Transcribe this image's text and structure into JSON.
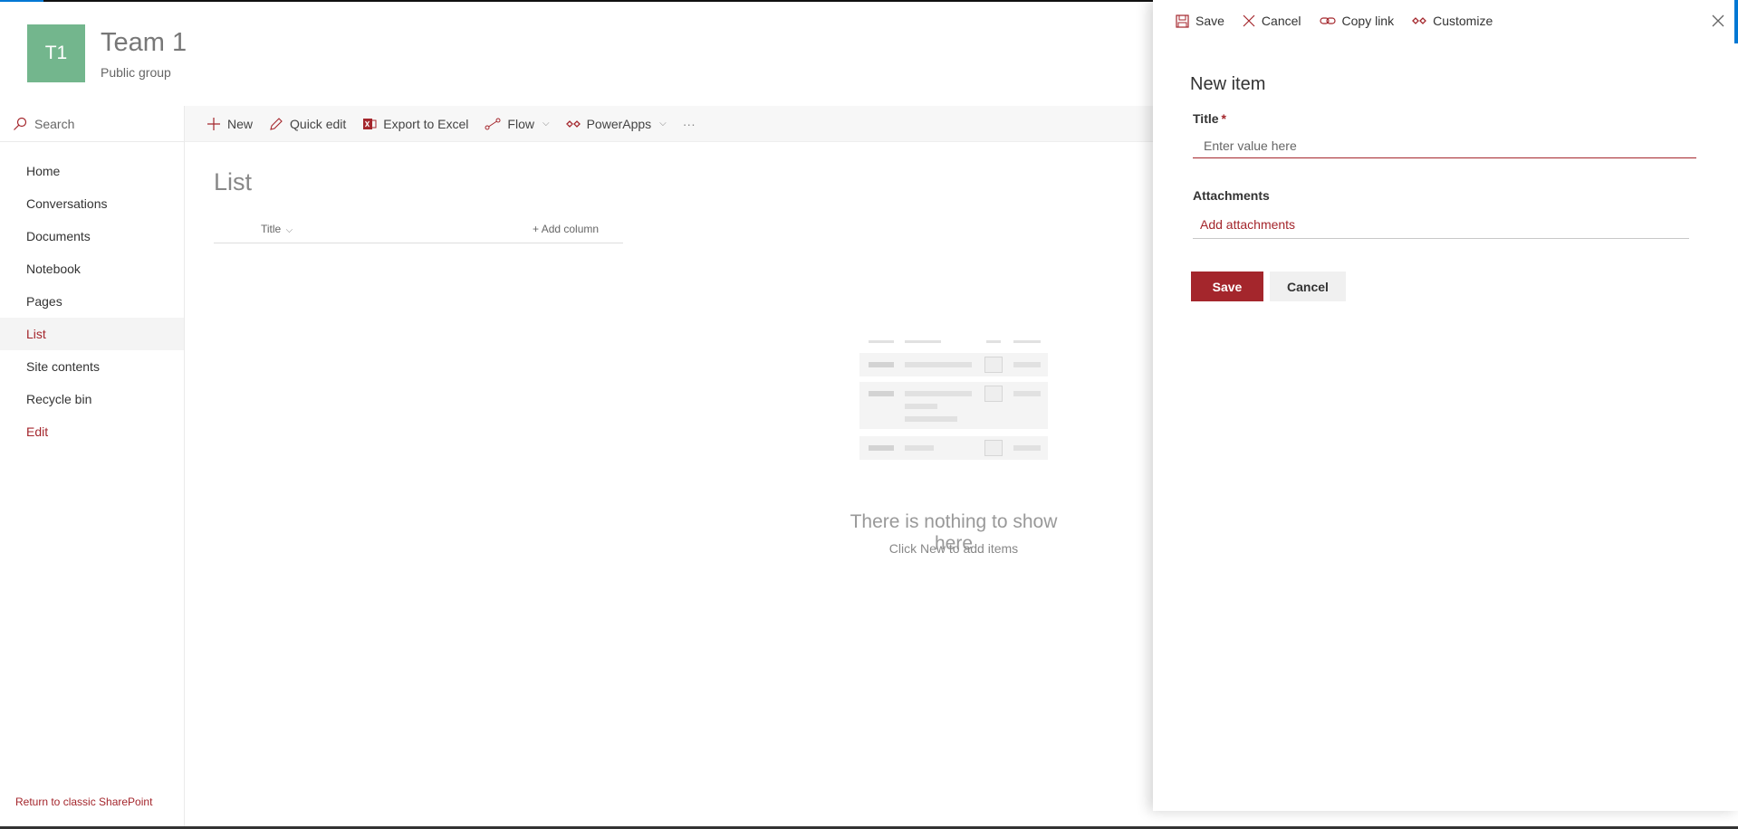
{
  "site": {
    "logo_initials": "T1",
    "title": "Team 1",
    "subtitle": "Public group"
  },
  "search": {
    "label": "Search"
  },
  "nav": {
    "items": [
      {
        "label": "Home"
      },
      {
        "label": "Conversations"
      },
      {
        "label": "Documents"
      },
      {
        "label": "Notebook"
      },
      {
        "label": "Pages"
      },
      {
        "label": "List",
        "active": true
      },
      {
        "label": "Site contents"
      },
      {
        "label": "Recycle bin"
      },
      {
        "label": "Edit"
      }
    ],
    "classic_link": "Return to classic SharePoint"
  },
  "commandbar": {
    "new": "New",
    "quick_edit": "Quick edit",
    "export": "Export to Excel",
    "flow": "Flow",
    "powerapps": "PowerApps",
    "more": "···"
  },
  "main": {
    "heading": "List",
    "columns": {
      "title": "Title",
      "add_column": "Add column"
    },
    "empty_title": "There is nothing to show here",
    "empty_subtitle": "Click New to add items"
  },
  "panel": {
    "commands": {
      "save": "Save",
      "cancel": "Cancel",
      "copy_link": "Copy link",
      "customize": "Customize"
    },
    "heading": "New item",
    "title_label": "Title",
    "required_mark": "*",
    "title_placeholder": "Enter value here",
    "title_value": "",
    "attachments_label": "Attachments",
    "add_attachments": "Add attachments",
    "save_button": "Save",
    "cancel_button": "Cancel"
  },
  "colors": {
    "accent": "#a4262c",
    "logo_bg": "#73b68d",
    "blue": "#0078d4"
  }
}
